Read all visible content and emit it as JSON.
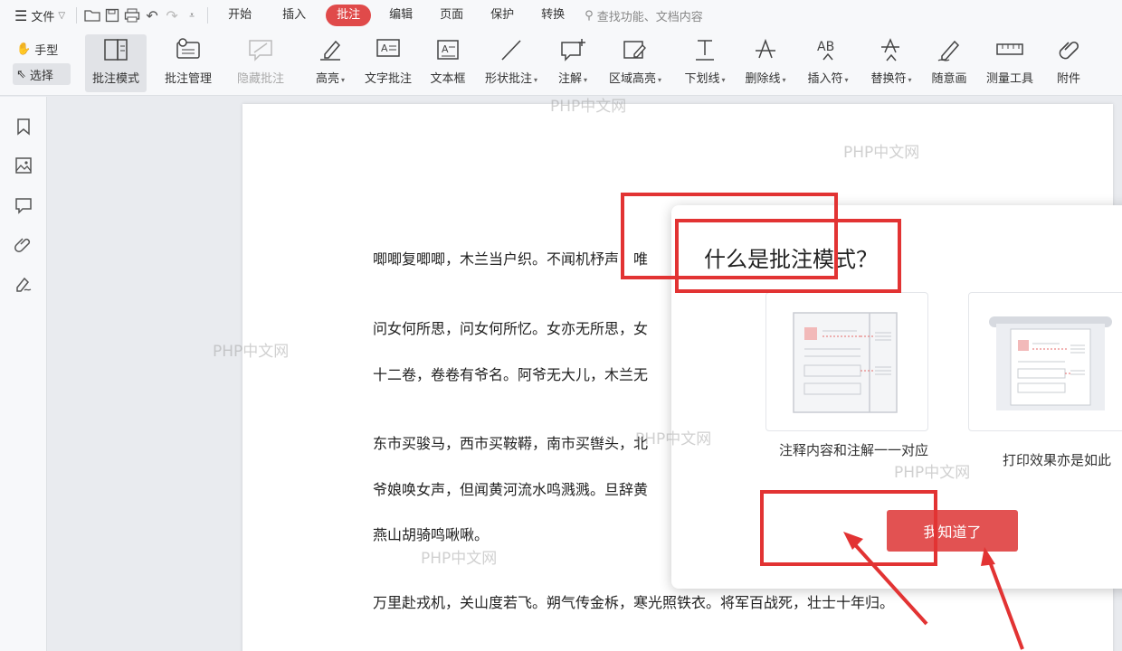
{
  "menubar": {
    "file_label": "文件",
    "tabs": [
      {
        "label": "开始"
      },
      {
        "label": "插入"
      },
      {
        "label": "批注"
      },
      {
        "label": "编辑"
      },
      {
        "label": "页面"
      },
      {
        "label": "保护"
      },
      {
        "label": "转换"
      }
    ],
    "search_placeholder": "查找功能、文档内容",
    "active_tab_color": "#e04a4a"
  },
  "ribbon": {
    "hand_label": "手型",
    "select_label": "选择",
    "tools": [
      {
        "label": "批注模式"
      },
      {
        "label": "批注管理"
      },
      {
        "label": "隐藏批注"
      },
      {
        "label": "高亮"
      },
      {
        "label": "文字批注"
      },
      {
        "label": "文本框"
      },
      {
        "label": "形状批注"
      },
      {
        "label": "注解"
      },
      {
        "label": "区域高亮"
      },
      {
        "label": "下划线"
      },
      {
        "label": "删除线"
      },
      {
        "label": "插入符"
      },
      {
        "label": "替换符"
      },
      {
        "label": "随意画"
      },
      {
        "label": "测量工具"
      },
      {
        "label": "附件"
      }
    ]
  },
  "document": {
    "lines": [
      "唧唧复唧唧，木兰当户织。不闻机杼声，唯",
      "问女何所思，问女何所忆。女亦无所思，女",
      "十二卷，卷卷有爷名。阿爷无大儿，木兰无",
      "东市买骏马，西市买鞍鞯，南市买辔头，北",
      "爷娘唤女声，但闻黄河流水鸣溅溅。旦辞黄",
      "燕山胡骑鸣啾啾。",
      "万里赴戎机，关山度若飞。朔气传金柝，寒光照铁衣。将军百战死，壮士十年归。"
    ]
  },
  "watermark": "PHP中文网",
  "dialog": {
    "title": "什么是批注模式？",
    "caption_left": "注释内容和注解一一对应",
    "caption_right": "打印效果亦是如此",
    "ok_label": "我知道了",
    "accent_color": "#e25252"
  }
}
